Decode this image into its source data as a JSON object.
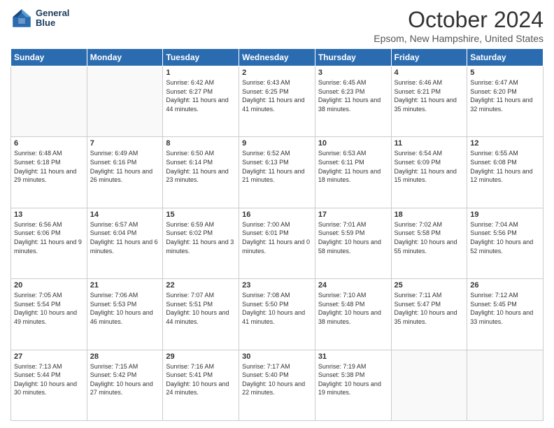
{
  "logo": {
    "line1": "General",
    "line2": "Blue"
  },
  "title": "October 2024",
  "subtitle": "Epsom, New Hampshire, United States",
  "headers": [
    "Sunday",
    "Monday",
    "Tuesday",
    "Wednesday",
    "Thursday",
    "Friday",
    "Saturday"
  ],
  "weeks": [
    [
      {
        "day": "",
        "sunrise": "",
        "sunset": "",
        "daylight": ""
      },
      {
        "day": "",
        "sunrise": "",
        "sunset": "",
        "daylight": ""
      },
      {
        "day": "1",
        "sunrise": "Sunrise: 6:42 AM",
        "sunset": "Sunset: 6:27 PM",
        "daylight": "Daylight: 11 hours and 44 minutes."
      },
      {
        "day": "2",
        "sunrise": "Sunrise: 6:43 AM",
        "sunset": "Sunset: 6:25 PM",
        "daylight": "Daylight: 11 hours and 41 minutes."
      },
      {
        "day": "3",
        "sunrise": "Sunrise: 6:45 AM",
        "sunset": "Sunset: 6:23 PM",
        "daylight": "Daylight: 11 hours and 38 minutes."
      },
      {
        "day": "4",
        "sunrise": "Sunrise: 6:46 AM",
        "sunset": "Sunset: 6:21 PM",
        "daylight": "Daylight: 11 hours and 35 minutes."
      },
      {
        "day": "5",
        "sunrise": "Sunrise: 6:47 AM",
        "sunset": "Sunset: 6:20 PM",
        "daylight": "Daylight: 11 hours and 32 minutes."
      }
    ],
    [
      {
        "day": "6",
        "sunrise": "Sunrise: 6:48 AM",
        "sunset": "Sunset: 6:18 PM",
        "daylight": "Daylight: 11 hours and 29 minutes."
      },
      {
        "day": "7",
        "sunrise": "Sunrise: 6:49 AM",
        "sunset": "Sunset: 6:16 PM",
        "daylight": "Daylight: 11 hours and 26 minutes."
      },
      {
        "day": "8",
        "sunrise": "Sunrise: 6:50 AM",
        "sunset": "Sunset: 6:14 PM",
        "daylight": "Daylight: 11 hours and 23 minutes."
      },
      {
        "day": "9",
        "sunrise": "Sunrise: 6:52 AM",
        "sunset": "Sunset: 6:13 PM",
        "daylight": "Daylight: 11 hours and 21 minutes."
      },
      {
        "day": "10",
        "sunrise": "Sunrise: 6:53 AM",
        "sunset": "Sunset: 6:11 PM",
        "daylight": "Daylight: 11 hours and 18 minutes."
      },
      {
        "day": "11",
        "sunrise": "Sunrise: 6:54 AM",
        "sunset": "Sunset: 6:09 PM",
        "daylight": "Daylight: 11 hours and 15 minutes."
      },
      {
        "day": "12",
        "sunrise": "Sunrise: 6:55 AM",
        "sunset": "Sunset: 6:08 PM",
        "daylight": "Daylight: 11 hours and 12 minutes."
      }
    ],
    [
      {
        "day": "13",
        "sunrise": "Sunrise: 6:56 AM",
        "sunset": "Sunset: 6:06 PM",
        "daylight": "Daylight: 11 hours and 9 minutes."
      },
      {
        "day": "14",
        "sunrise": "Sunrise: 6:57 AM",
        "sunset": "Sunset: 6:04 PM",
        "daylight": "Daylight: 11 hours and 6 minutes."
      },
      {
        "day": "15",
        "sunrise": "Sunrise: 6:59 AM",
        "sunset": "Sunset: 6:02 PM",
        "daylight": "Daylight: 11 hours and 3 minutes."
      },
      {
        "day": "16",
        "sunrise": "Sunrise: 7:00 AM",
        "sunset": "Sunset: 6:01 PM",
        "daylight": "Daylight: 11 hours and 0 minutes."
      },
      {
        "day": "17",
        "sunrise": "Sunrise: 7:01 AM",
        "sunset": "Sunset: 5:59 PM",
        "daylight": "Daylight: 10 hours and 58 minutes."
      },
      {
        "day": "18",
        "sunrise": "Sunrise: 7:02 AM",
        "sunset": "Sunset: 5:58 PM",
        "daylight": "Daylight: 10 hours and 55 minutes."
      },
      {
        "day": "19",
        "sunrise": "Sunrise: 7:04 AM",
        "sunset": "Sunset: 5:56 PM",
        "daylight": "Daylight: 10 hours and 52 minutes."
      }
    ],
    [
      {
        "day": "20",
        "sunrise": "Sunrise: 7:05 AM",
        "sunset": "Sunset: 5:54 PM",
        "daylight": "Daylight: 10 hours and 49 minutes."
      },
      {
        "day": "21",
        "sunrise": "Sunrise: 7:06 AM",
        "sunset": "Sunset: 5:53 PM",
        "daylight": "Daylight: 10 hours and 46 minutes."
      },
      {
        "day": "22",
        "sunrise": "Sunrise: 7:07 AM",
        "sunset": "Sunset: 5:51 PM",
        "daylight": "Daylight: 10 hours and 44 minutes."
      },
      {
        "day": "23",
        "sunrise": "Sunrise: 7:08 AM",
        "sunset": "Sunset: 5:50 PM",
        "daylight": "Daylight: 10 hours and 41 minutes."
      },
      {
        "day": "24",
        "sunrise": "Sunrise: 7:10 AM",
        "sunset": "Sunset: 5:48 PM",
        "daylight": "Daylight: 10 hours and 38 minutes."
      },
      {
        "day": "25",
        "sunrise": "Sunrise: 7:11 AM",
        "sunset": "Sunset: 5:47 PM",
        "daylight": "Daylight: 10 hours and 35 minutes."
      },
      {
        "day": "26",
        "sunrise": "Sunrise: 7:12 AM",
        "sunset": "Sunset: 5:45 PM",
        "daylight": "Daylight: 10 hours and 33 minutes."
      }
    ],
    [
      {
        "day": "27",
        "sunrise": "Sunrise: 7:13 AM",
        "sunset": "Sunset: 5:44 PM",
        "daylight": "Daylight: 10 hours and 30 minutes."
      },
      {
        "day": "28",
        "sunrise": "Sunrise: 7:15 AM",
        "sunset": "Sunset: 5:42 PM",
        "daylight": "Daylight: 10 hours and 27 minutes."
      },
      {
        "day": "29",
        "sunrise": "Sunrise: 7:16 AM",
        "sunset": "Sunset: 5:41 PM",
        "daylight": "Daylight: 10 hours and 24 minutes."
      },
      {
        "day": "30",
        "sunrise": "Sunrise: 7:17 AM",
        "sunset": "Sunset: 5:40 PM",
        "daylight": "Daylight: 10 hours and 22 minutes."
      },
      {
        "day": "31",
        "sunrise": "Sunrise: 7:19 AM",
        "sunset": "Sunset: 5:38 PM",
        "daylight": "Daylight: 10 hours and 19 minutes."
      },
      {
        "day": "",
        "sunrise": "",
        "sunset": "",
        "daylight": ""
      },
      {
        "day": "",
        "sunrise": "",
        "sunset": "",
        "daylight": ""
      }
    ]
  ]
}
